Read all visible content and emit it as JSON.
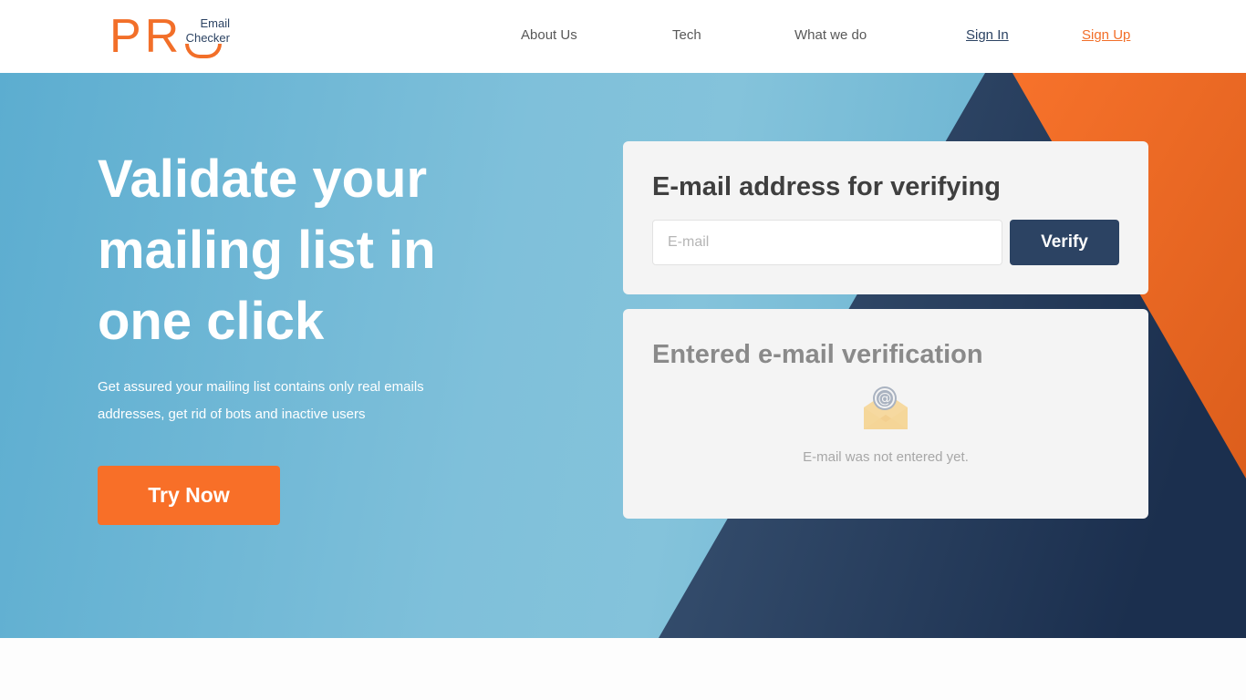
{
  "header": {
    "logo": {
      "mark": "PR",
      "line1": "Email",
      "line2": "Checker"
    },
    "nav": [
      {
        "label": "About Us"
      },
      {
        "label": "Tech"
      },
      {
        "label": "What we do"
      },
      {
        "label": "Sign In"
      },
      {
        "label": "Sign Up"
      }
    ]
  },
  "hero": {
    "title": "Validate your mailing list in one click",
    "subtitle": "Get assured your mailing list contains only real emails addresses, get rid of bots and inactive users",
    "cta_label": "Try Now"
  },
  "verify_card": {
    "title": "E-mail address for verifying",
    "email_value": "",
    "email_placeholder": "E-mail",
    "button_label": "Verify"
  },
  "result_card": {
    "title": "Entered e-mail verification",
    "icon": "open-envelope-at-icon",
    "empty_message": "E-mail was not entered yet."
  },
  "colors": {
    "brand_orange": "#f26f29",
    "brand_navy": "#2c4363",
    "hero_blue": "#7fc0da",
    "card_bg": "#f4f4f4"
  }
}
